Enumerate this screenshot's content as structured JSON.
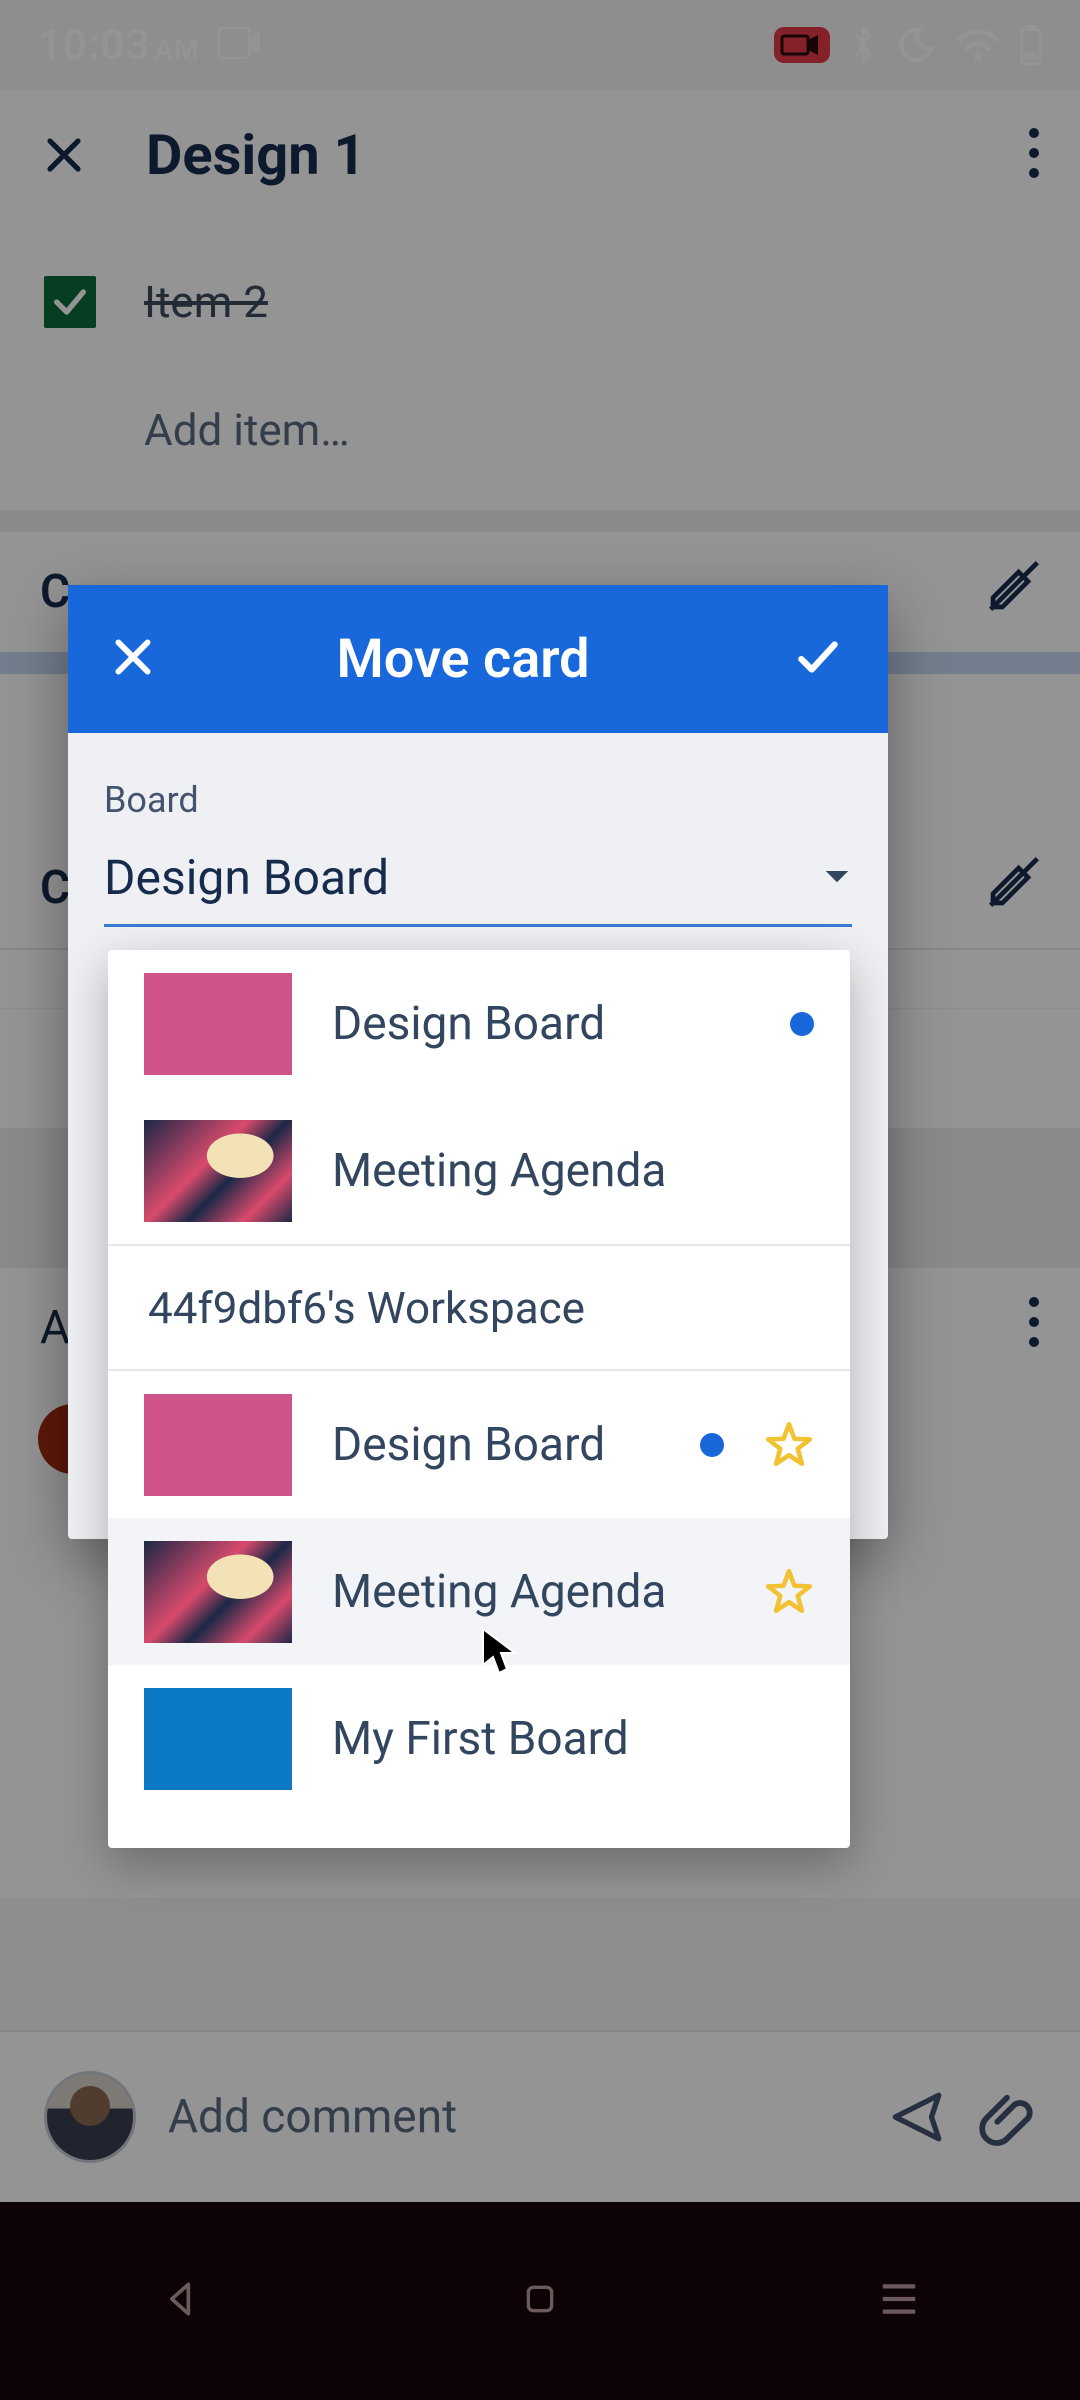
{
  "status": {
    "time": "10:03",
    "ampm": "AM"
  },
  "appbar": {
    "title": "Design 1"
  },
  "checklist": {
    "item_label": "Item 2",
    "add_placeholder": "Add item…"
  },
  "bg": {
    "c_prefix": "C",
    "a_prefix": "A"
  },
  "comment": {
    "placeholder": "Add comment"
  },
  "modal": {
    "title": "Move card",
    "field_label": "Board",
    "selected": "Design Board"
  },
  "dropdown": {
    "recent0": "Design Board",
    "recent1": "Meeting Agenda",
    "workspace_label": "44f9dbf6's Workspace",
    "item0": "Design Board",
    "item1": "Meeting Agenda",
    "item2": "My First Board"
  }
}
